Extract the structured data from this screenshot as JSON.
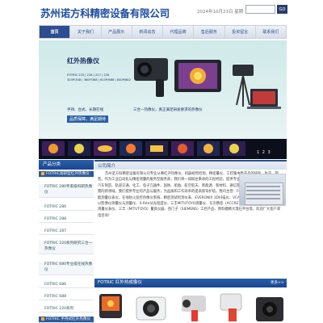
{
  "header": {
    "title": "苏州诺方科精密设备有限公司",
    "date": "2024年10月23日 星期",
    "search_button": "GO"
  },
  "nav": {
    "items": [
      "首页",
      "关于我们",
      "产品展示",
      "新闻动态",
      "代理品牌",
      "售后服务",
      "投资留言",
      "联系我们"
    ]
  },
  "banner": {
    "title": "红外热像仪",
    "models_line1": "FOTRIC 225 | 226 | 227 | 228",
    "models_line2": "320P/348 | 360P/368 | 615P/686 | 640P/682",
    "tags": "手持、台式、长期在线",
    "highlight": "三合一热像仪，真正满足研发要求的热像仪",
    "slogan": "品质保障，满足期待",
    "pager": "1 2 3"
  },
  "sidebar": {
    "header": "产品分类",
    "items": [
      {
        "label": "FOTRIC高研型红外热像仪",
        "type": "cat"
      },
      {
        "label": "FOTRIC 280专家级科研热像仪",
        "type": "sub"
      },
      {
        "label": "FOTRIC 286",
        "type": "item"
      },
      {
        "label": "FOTRIC 288",
        "type": "item"
      },
      {
        "label": "FOTRIC 287",
        "type": "item"
      },
      {
        "label": "FOTRIC 220系列研究三合一热像仪",
        "type": "sub"
      },
      {
        "label": "FOTRIC 680专业级在线热像仪",
        "type": "sub"
      },
      {
        "label": "FOTRIC 686",
        "type": "item"
      },
      {
        "label": "FOTRIC 688",
        "type": "item"
      },
      {
        "label": "FOTRIC 220系列",
        "type": "item"
      },
      {
        "label": "FOTRIC 手持式红外热像仪",
        "type": "cat"
      }
    ]
  },
  "about": {
    "header": "公司简介",
    "text": "苏州诺方科精密设备有限公司专业从事红外热像仪、机器视觉检测、精密量仪、工控集中集产品的研发、生产、销售。作为工业自动化与精密测量的服务型服务商，我们将一如既往秉承的工程经验，提供专业的检测和精密方案，服务于汽车制造、轨道交通、化工、电子元器件、国防、船舶、航空航天、新能源、新材料、通信等国内外多行业，探索客户所需的新领域。我们提供专业的产品与服务，为品质和工作效率的提高保驾护航。我司主营：FOTRIC红外热像仪、检测智能测量仪表仪、在线防火监控热像仪系统、精密测试检测仪表、EVERONIX 3D扫描仪、VCA一键式测量仪、威尔WALEN以影像仪测量仪与测量仪、X-Rite分光密度仪、三丰MITUTOYO测量仪、东京精密（ACCRETECH）和影像测量仪测量仪测量仪表仪、三丰（MITUTOYO）量具仪器、西门子（SIEMENS）工控产品、原料模精大理石平台等，欢迎广大客户来电咨询！"
  },
  "products": {
    "header": "FOTRIC 红外热成像仪",
    "more": "更多>>"
  },
  "colors": {
    "primary": "#1f4ea3",
    "nav_active": "#2c4d8f",
    "banner_accent": "#2a5fa8",
    "cat_bullet": "#f2b437"
  }
}
